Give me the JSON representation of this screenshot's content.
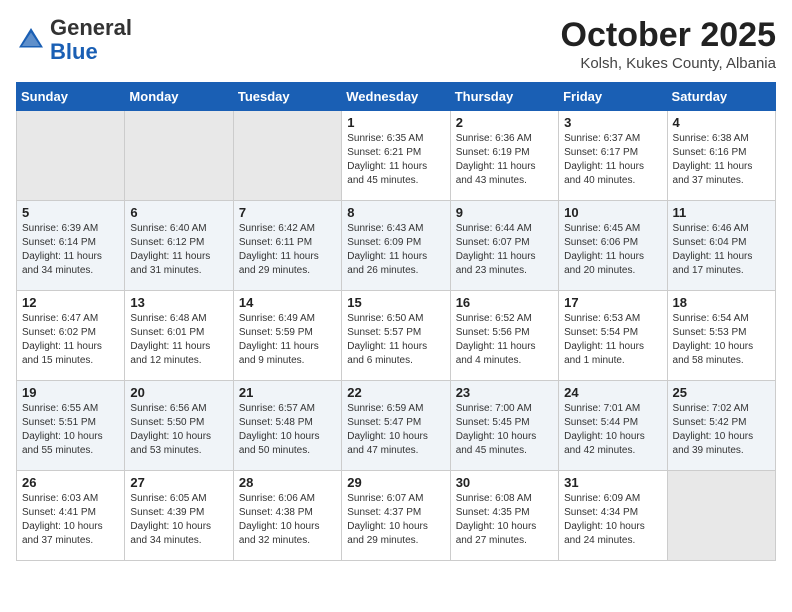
{
  "header": {
    "logo_general": "General",
    "logo_blue": "Blue",
    "month": "October 2025",
    "location": "Kolsh, Kukes County, Albania"
  },
  "weekdays": [
    "Sunday",
    "Monday",
    "Tuesday",
    "Wednesday",
    "Thursday",
    "Friday",
    "Saturday"
  ],
  "weeks": [
    [
      {
        "day": "",
        "info": ""
      },
      {
        "day": "",
        "info": ""
      },
      {
        "day": "",
        "info": ""
      },
      {
        "day": "1",
        "info": "Sunrise: 6:35 AM\nSunset: 6:21 PM\nDaylight: 11 hours\nand 45 minutes."
      },
      {
        "day": "2",
        "info": "Sunrise: 6:36 AM\nSunset: 6:19 PM\nDaylight: 11 hours\nand 43 minutes."
      },
      {
        "day": "3",
        "info": "Sunrise: 6:37 AM\nSunset: 6:17 PM\nDaylight: 11 hours\nand 40 minutes."
      },
      {
        "day": "4",
        "info": "Sunrise: 6:38 AM\nSunset: 6:16 PM\nDaylight: 11 hours\nand 37 minutes."
      }
    ],
    [
      {
        "day": "5",
        "info": "Sunrise: 6:39 AM\nSunset: 6:14 PM\nDaylight: 11 hours\nand 34 minutes."
      },
      {
        "day": "6",
        "info": "Sunrise: 6:40 AM\nSunset: 6:12 PM\nDaylight: 11 hours\nand 31 minutes."
      },
      {
        "day": "7",
        "info": "Sunrise: 6:42 AM\nSunset: 6:11 PM\nDaylight: 11 hours\nand 29 minutes."
      },
      {
        "day": "8",
        "info": "Sunrise: 6:43 AM\nSunset: 6:09 PM\nDaylight: 11 hours\nand 26 minutes."
      },
      {
        "day": "9",
        "info": "Sunrise: 6:44 AM\nSunset: 6:07 PM\nDaylight: 11 hours\nand 23 minutes."
      },
      {
        "day": "10",
        "info": "Sunrise: 6:45 AM\nSunset: 6:06 PM\nDaylight: 11 hours\nand 20 minutes."
      },
      {
        "day": "11",
        "info": "Sunrise: 6:46 AM\nSunset: 6:04 PM\nDaylight: 11 hours\nand 17 minutes."
      }
    ],
    [
      {
        "day": "12",
        "info": "Sunrise: 6:47 AM\nSunset: 6:02 PM\nDaylight: 11 hours\nand 15 minutes."
      },
      {
        "day": "13",
        "info": "Sunrise: 6:48 AM\nSunset: 6:01 PM\nDaylight: 11 hours\nand 12 minutes."
      },
      {
        "day": "14",
        "info": "Sunrise: 6:49 AM\nSunset: 5:59 PM\nDaylight: 11 hours\nand 9 minutes."
      },
      {
        "day": "15",
        "info": "Sunrise: 6:50 AM\nSunset: 5:57 PM\nDaylight: 11 hours\nand 6 minutes."
      },
      {
        "day": "16",
        "info": "Sunrise: 6:52 AM\nSunset: 5:56 PM\nDaylight: 11 hours\nand 4 minutes."
      },
      {
        "day": "17",
        "info": "Sunrise: 6:53 AM\nSunset: 5:54 PM\nDaylight: 11 hours\nand 1 minute."
      },
      {
        "day": "18",
        "info": "Sunrise: 6:54 AM\nSunset: 5:53 PM\nDaylight: 10 hours\nand 58 minutes."
      }
    ],
    [
      {
        "day": "19",
        "info": "Sunrise: 6:55 AM\nSunset: 5:51 PM\nDaylight: 10 hours\nand 55 minutes."
      },
      {
        "day": "20",
        "info": "Sunrise: 6:56 AM\nSunset: 5:50 PM\nDaylight: 10 hours\nand 53 minutes."
      },
      {
        "day": "21",
        "info": "Sunrise: 6:57 AM\nSunset: 5:48 PM\nDaylight: 10 hours\nand 50 minutes."
      },
      {
        "day": "22",
        "info": "Sunrise: 6:59 AM\nSunset: 5:47 PM\nDaylight: 10 hours\nand 47 minutes."
      },
      {
        "day": "23",
        "info": "Sunrise: 7:00 AM\nSunset: 5:45 PM\nDaylight: 10 hours\nand 45 minutes."
      },
      {
        "day": "24",
        "info": "Sunrise: 7:01 AM\nSunset: 5:44 PM\nDaylight: 10 hours\nand 42 minutes."
      },
      {
        "day": "25",
        "info": "Sunrise: 7:02 AM\nSunset: 5:42 PM\nDaylight: 10 hours\nand 39 minutes."
      }
    ],
    [
      {
        "day": "26",
        "info": "Sunrise: 6:03 AM\nSunset: 4:41 PM\nDaylight: 10 hours\nand 37 minutes."
      },
      {
        "day": "27",
        "info": "Sunrise: 6:05 AM\nSunset: 4:39 PM\nDaylight: 10 hours\nand 34 minutes."
      },
      {
        "day": "28",
        "info": "Sunrise: 6:06 AM\nSunset: 4:38 PM\nDaylight: 10 hours\nand 32 minutes."
      },
      {
        "day": "29",
        "info": "Sunrise: 6:07 AM\nSunset: 4:37 PM\nDaylight: 10 hours\nand 29 minutes."
      },
      {
        "day": "30",
        "info": "Sunrise: 6:08 AM\nSunset: 4:35 PM\nDaylight: 10 hours\nand 27 minutes."
      },
      {
        "day": "31",
        "info": "Sunrise: 6:09 AM\nSunset: 4:34 PM\nDaylight: 10 hours\nand 24 minutes."
      },
      {
        "day": "",
        "info": ""
      }
    ]
  ]
}
